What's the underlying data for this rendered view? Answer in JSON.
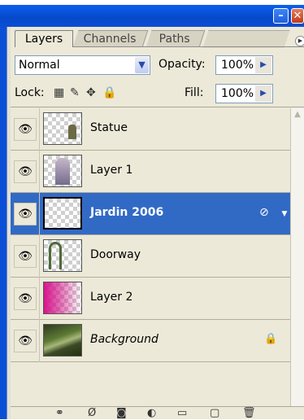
{
  "titlebar": {
    "minimize_icon": "minimize-icon",
    "close_icon": "close-icon"
  },
  "tabs": [
    {
      "label": "Layers",
      "active": true
    },
    {
      "label": "Channels",
      "active": false
    },
    {
      "label": "Paths",
      "active": false
    }
  ],
  "toolbar": {
    "blend_mode": "Normal",
    "opacity_label": "Opacity:",
    "opacity_value": "100%",
    "lock_label": "Lock:",
    "fill_label": "Fill:",
    "fill_value": "100%"
  },
  "layers": [
    {
      "name": "Statue",
      "visible": true,
      "selected": false
    },
    {
      "name": "Layer 1",
      "visible": true,
      "selected": false
    },
    {
      "name": "Jardin 2006",
      "visible": true,
      "selected": true
    },
    {
      "name": "Doorway",
      "visible": true,
      "selected": false
    },
    {
      "name": "Layer 2",
      "visible": true,
      "selected": false
    },
    {
      "name": "Background",
      "visible": true,
      "selected": false,
      "locked": true
    }
  ],
  "colors": {
    "titlebar": "#0a5ae6",
    "selection": "#316ac5",
    "panel": "#ece9d8"
  }
}
